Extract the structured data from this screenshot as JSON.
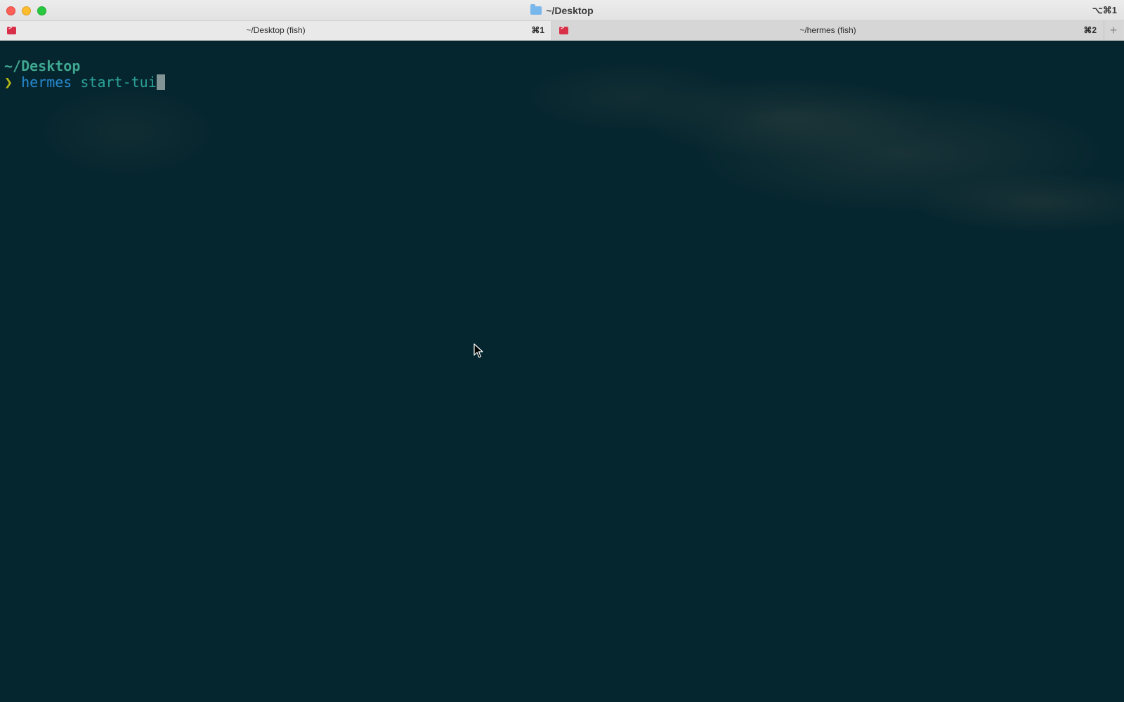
{
  "window": {
    "title": "~/Desktop",
    "title_icon": "folder-icon",
    "shortcut": "⌥⌘1"
  },
  "tabs": [
    {
      "label": "~/Desktop (fish)",
      "shortcut": "⌘1",
      "active": true,
      "icon": "terminal-icon"
    },
    {
      "label": "~/hermes (fish)",
      "shortcut": "⌘2",
      "active": false,
      "icon": "terminal-icon"
    }
  ],
  "new_tab_label": "+",
  "terminal": {
    "cwd": "~/Desktop",
    "prompt_char": "❯",
    "command": "hermes",
    "argument": "start-tui"
  },
  "colors": {
    "terminal_bg": "#06262f",
    "cwd": "#3fa891",
    "prompt": "#b5b814",
    "command": "#268bd2",
    "argument": "#2aa198"
  }
}
